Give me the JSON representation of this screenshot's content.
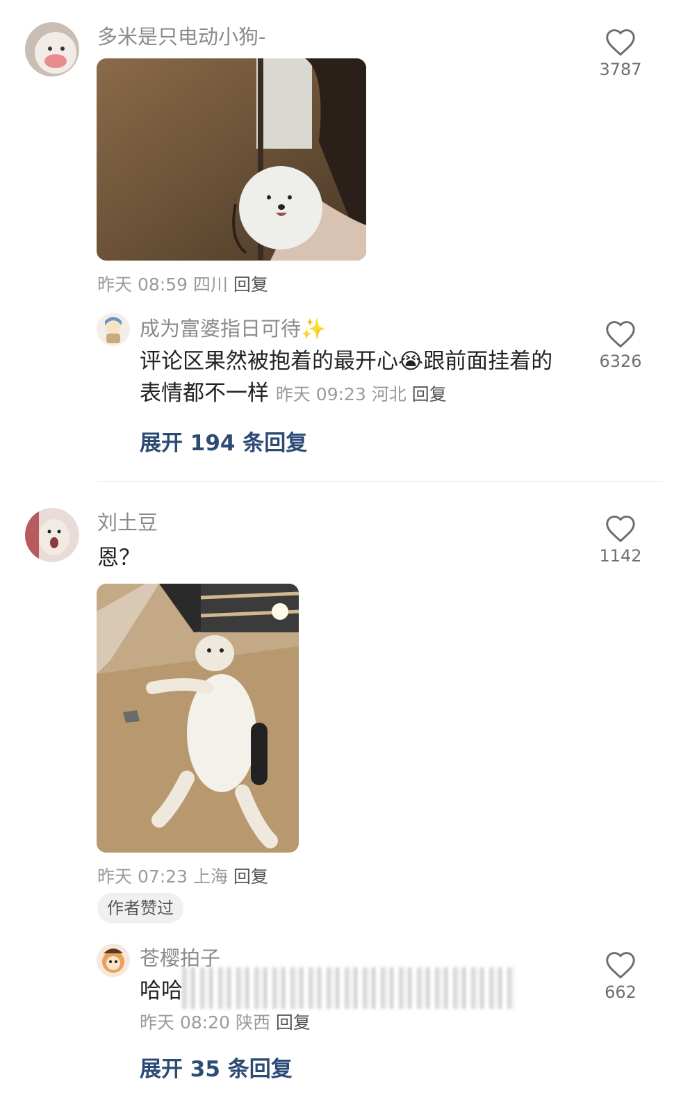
{
  "comments": [
    {
      "username": "多米是只电动小狗-",
      "time": "昨天 08:59",
      "location": "四川",
      "reply_label": "回复",
      "likes": "3787",
      "reply": {
        "username": "成为富婆指日可待",
        "username_emoji": "✨",
        "text_part1": "评论区果然被抱着的最开心",
        "emoji": "😭",
        "text_part2": "跟前面挂着的表情都不一样",
        "time": "昨天 09:23",
        "location": "河北",
        "reply_label": "回复",
        "likes": "6326"
      },
      "expand_label": "展开 194 条回复"
    },
    {
      "username": "刘土豆",
      "text": "恩？",
      "time": "昨天 07:23",
      "location": "上海",
      "reply_label": "回复",
      "likes": "1142",
      "author_badge": "作者赞过",
      "reply": {
        "username": "苍樱拍子",
        "text": "哈哈",
        "time": "昨天 08:20",
        "location": "陕西",
        "reply_label": "回复",
        "likes": "662"
      },
      "expand_label": "展开 35 条回复"
    }
  ],
  "icons": {
    "like": "heart-outline-icon"
  },
  "colors": {
    "link": "#2c4a76",
    "muted": "#9a9a9a"
  }
}
